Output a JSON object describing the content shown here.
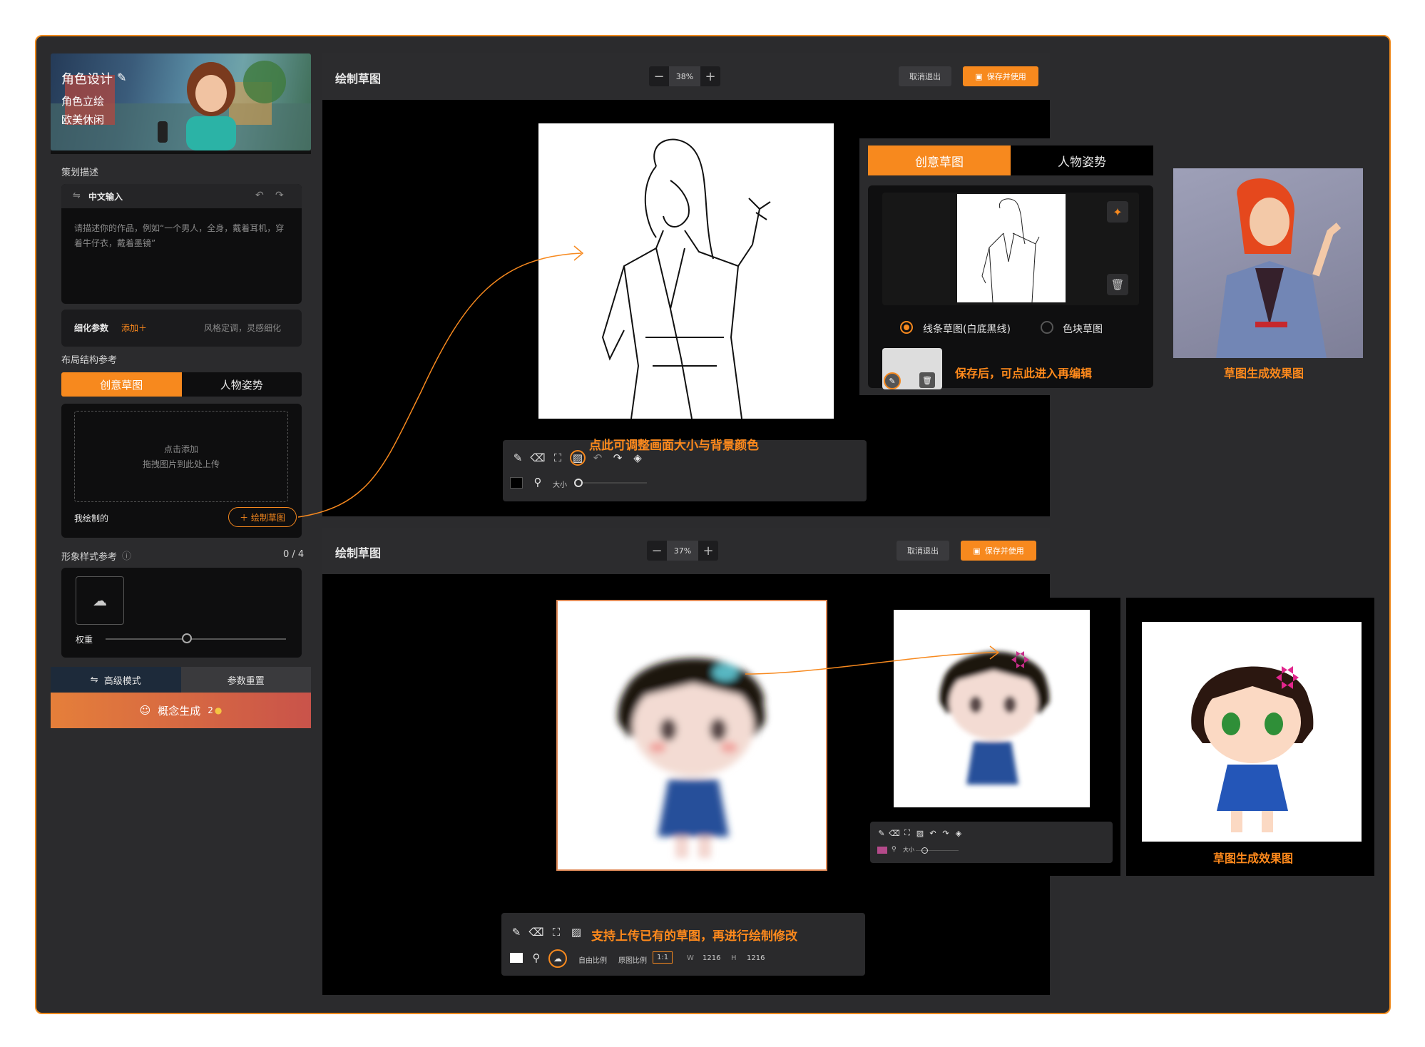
{
  "sidebar": {
    "banner": {
      "title": "角色设计",
      "sub1": "角色立绘",
      "sub2": "欧美休闲"
    },
    "plan_label": "策划描述",
    "input_mode": "中文输入",
    "prompt_placeholder": "请描述你的作品，例如“一个男人，全身，戴着耳机，穿着牛仔衣，戴着墨镜”",
    "refine_label": "细化参数",
    "refine_add": "添加＋",
    "refine_hint": "风格定调，灵感细化",
    "layout_label": "布局结构参考",
    "tabs": [
      "创意草图",
      "人物姿势"
    ],
    "upload_line1": "点击添加",
    "upload_line2": "拖拽图片到此处上传",
    "my_drawing": "我绘制的",
    "draw_button": "＋ 绘制草图",
    "style_label": "形象样式参考",
    "style_count": "0 / 4",
    "weight_label": "权重",
    "weight_value": 0.45,
    "advanced": "高级模式",
    "reset": "参数重置",
    "generate": "概念生成",
    "generate_cost": "2"
  },
  "editor1": {
    "title": "绘制草图",
    "zoom": "38%",
    "cancel": "取消退出",
    "save": "保存并使用",
    "callout": "点此可调整画面大小与背景颜色",
    "size_label": "大小"
  },
  "editor2": {
    "title": "绘制草图",
    "zoom": "37%",
    "cancel": "取消退出",
    "save": "保存并使用",
    "callout": "支持上传已有的草图，再进行绘制修改",
    "free_ratio": "自由比例",
    "orig_ratio": "原图比例",
    "ratio": "1:1",
    "w_label": "W",
    "w_value": "1216",
    "h_label": "H",
    "h_value": "1216",
    "mini_size_label": "大小"
  },
  "popup": {
    "tabs": [
      "创意草图",
      "人物姿势"
    ],
    "option_line": "线条草图(白底黑线)",
    "option_block": "色块草图",
    "save_hint": "保存后，可点此进入再编辑"
  },
  "results": {
    "caption_top": "草图生成效果图",
    "caption_bottom": "草图生成效果图"
  },
  "colors": {
    "accent": "#f7891e",
    "bg": "#2b2b2d",
    "panel": "#0e0e0f"
  }
}
